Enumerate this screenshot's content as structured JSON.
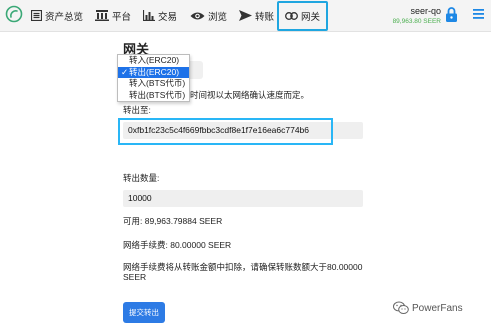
{
  "nav": {
    "items": [
      {
        "label": "资产总览",
        "icon": "dashboard-icon"
      },
      {
        "label": "平台",
        "icon": "exchange-platform-icon"
      },
      {
        "label": "交易",
        "icon": "bar-chart-icon"
      },
      {
        "label": "浏览",
        "icon": "eye-icon"
      },
      {
        "label": "转账",
        "icon": "send-arrow-icon"
      },
      {
        "label": "网关",
        "icon": "link-icon"
      }
    ],
    "active": "网关"
  },
  "account": {
    "name": "seer-qo",
    "balance": "89,963.80 SEER"
  },
  "page": {
    "title": "网关",
    "gateway_options": [
      "转入(ERC20)",
      "转出(ERC20)",
      "转入(BTS代币)",
      "转出(BTS代币)"
    ],
    "selected_option": "转出(ERC20)",
    "note_text": "时间视以太网络确认速度而定。",
    "address_label": "转出至:",
    "address_value": "0xfb1fc23c5c4f669fbbc3cdf8e1f7e16ea6c774b6",
    "amount_label": "转出数量:",
    "amount_value": "10000",
    "available_text": "可用: 89,963.79884 SEER",
    "fee_text": "网络手续费: 80.00000 SEER",
    "warning_text": "网络手续费将从转账金额中扣除，请确保转账数额大于80.00000 SEER",
    "submit_label": "提交转出"
  },
  "watermark": {
    "text": "PowerFans"
  },
  "colors": {
    "accent": "#2d7be5",
    "highlight": "#29b6f6",
    "balance": "#4caf50",
    "lock": "#1e88e5"
  }
}
